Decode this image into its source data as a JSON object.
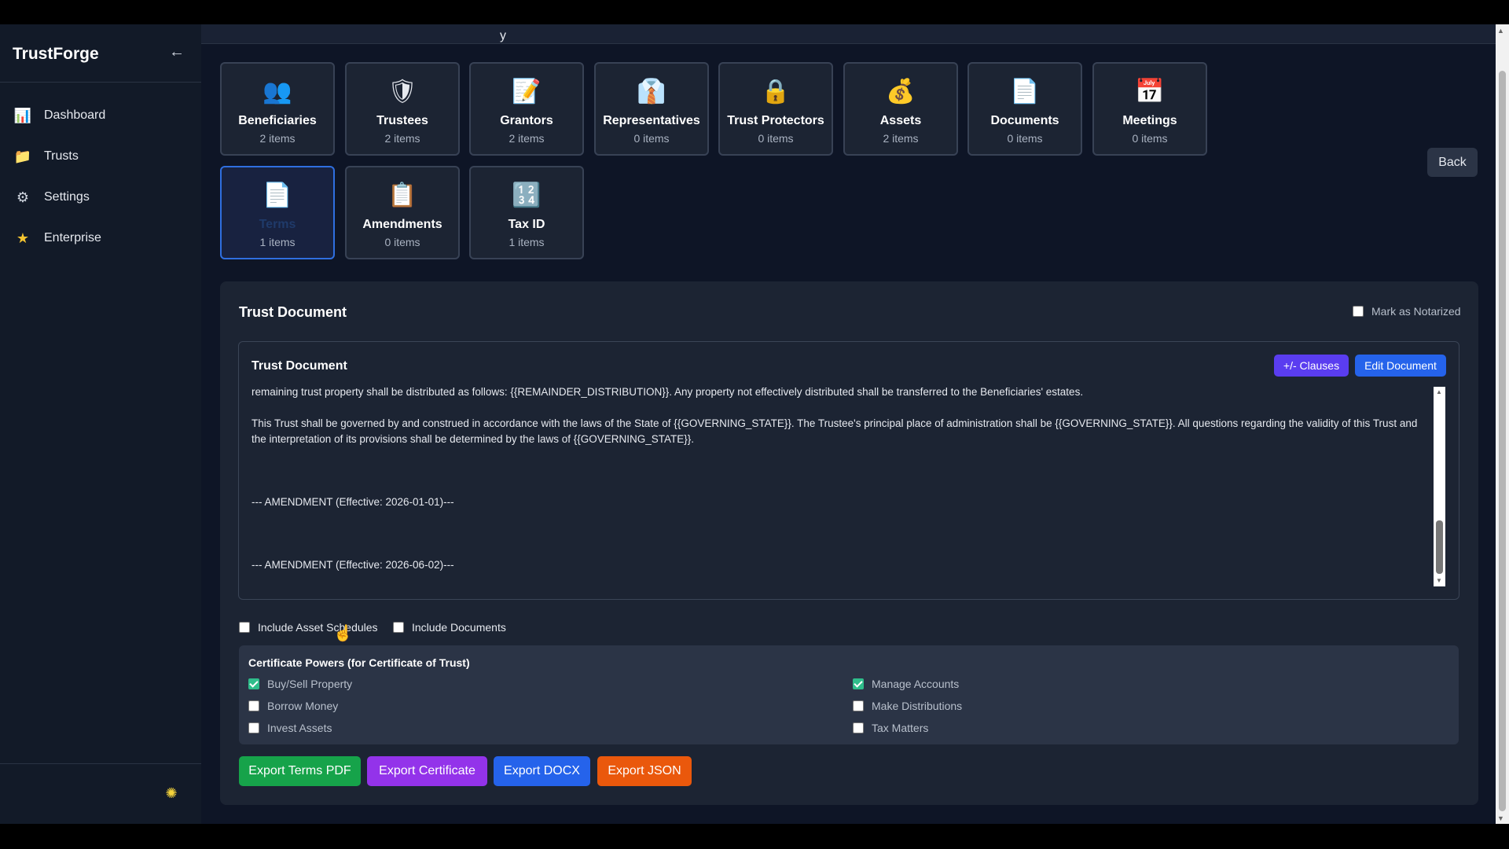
{
  "sidebar": {
    "brand": "TrustForge",
    "collapse_icon": "←",
    "items": [
      {
        "label": "Dashboard",
        "icon": "📊"
      },
      {
        "label": "Trusts",
        "icon": "📁"
      },
      {
        "label": "Settings",
        "icon": "⚙"
      },
      {
        "label": "Enterprise",
        "icon": "★"
      }
    ],
    "theme_icon": "✺"
  },
  "header": {
    "partial_text": "y"
  },
  "tiles": [
    {
      "label": "Beneficiaries",
      "count": "2 items",
      "icon": "👥"
    },
    {
      "label": "Trustees",
      "count": "2 items",
      "icon": "🛡"
    },
    {
      "label": "Grantors",
      "count": "2 items",
      "icon": "📝"
    },
    {
      "label": "Representatives",
      "count": "0 items",
      "icon": "👔"
    },
    {
      "label": "Trust Protectors",
      "count": "0 items",
      "icon": "🔒"
    },
    {
      "label": "Assets",
      "count": "2 items",
      "icon": "💰"
    },
    {
      "label": "Documents",
      "count": "0 items",
      "icon": "📄"
    },
    {
      "label": "Meetings",
      "count": "0 items",
      "icon": "📅"
    },
    {
      "label": "Terms",
      "count": "1 items",
      "icon": "📄"
    },
    {
      "label": "Amendments",
      "count": "0 items",
      "icon": "📋"
    },
    {
      "label": "Tax ID",
      "count": "1 items",
      "icon": "🔢"
    }
  ],
  "back_label": "Back",
  "panel": {
    "title": "Trust Document",
    "notarized_label": "Mark as Notarized",
    "doc_title": "Trust Document",
    "clauses_label": "+/- Clauses",
    "edit_label": "Edit Document",
    "paragraphs": [
      "remaining trust property shall be distributed as follows: {{REMAINDER_DISTRIBUTION}}. Any property not effectively distributed shall be transferred to the Beneficiaries' estates.",
      "This Trust shall be governed by and construed in accordance with the laws of the State of {{GOVERNING_STATE}}. The Trustee's principal place of administration shall be {{GOVERNING_STATE}}. All questions regarding the validity of this Trust and the interpretation of its provisions shall be determined by the laws of {{GOVERNING_STATE}}.",
      "--- AMENDMENT (Effective: 2026-01-01)---",
      "--- AMENDMENT (Effective: 2026-06-02)---"
    ],
    "include_asset_label": "Include Asset Schedules",
    "include_docs_label": "Include Documents",
    "cert_title": "Certificate Powers (for Certificate of Trust)",
    "powers": [
      {
        "label": "Buy/Sell Property",
        "checked": true
      },
      {
        "label": "Borrow Money",
        "checked": false
      },
      {
        "label": "Invest Assets",
        "checked": false
      },
      {
        "label": "Manage Accounts",
        "checked": true
      },
      {
        "label": "Make Distributions",
        "checked": false
      },
      {
        "label": "Tax Matters",
        "checked": false
      }
    ],
    "exports": [
      {
        "label": "Export Terms PDF",
        "color": "#16a34a"
      },
      {
        "label": "Export Certificate",
        "color": "#9333ea"
      },
      {
        "label": "Export DOCX",
        "color": "#2563eb"
      },
      {
        "label": "Export JSON",
        "color": "#ea580c"
      }
    ]
  }
}
